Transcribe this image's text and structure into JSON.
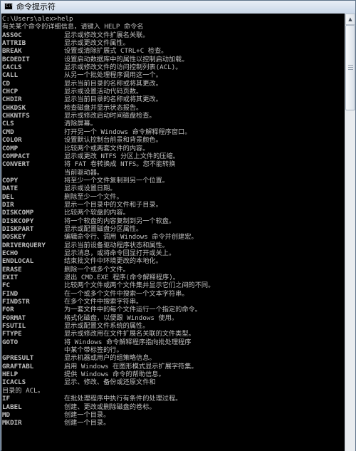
{
  "window": {
    "title": "命令提示符",
    "icon_text": "C:\\"
  },
  "console": {
    "prompt_line": "C:\\Users\\alex>help",
    "intro_line": "有关某个命令的详细信息，请键入 HELP 命令名",
    "entries": [
      {
        "cmd": "ASSOC",
        "desc": "显示或修改文件扩展名关联。"
      },
      {
        "cmd": "ATTRIB",
        "desc": "显示或更改文件属性。"
      },
      {
        "cmd": "BREAK",
        "desc": "设置或清除扩展式 CTRL+C 检查。"
      },
      {
        "cmd": "BCDEDIT",
        "desc": "设置启动数据库中的属性以控制启动加载。"
      },
      {
        "cmd": "CACLS",
        "desc": "显示或修改文件的访问控制列表(ACL)。"
      },
      {
        "cmd": "CALL",
        "desc": "从另一个批处理程序调用这一个。"
      },
      {
        "cmd": "CD",
        "desc": "显示当前目录的名称或将其更改。"
      },
      {
        "cmd": "CHCP",
        "desc": "显示或设置活动代码页数。"
      },
      {
        "cmd": "CHDIR",
        "desc": "显示当前目录的名称或将其更改。"
      },
      {
        "cmd": "CHKDSK",
        "desc": "检查磁盘并显示状态报告。"
      },
      {
        "cmd": "CHKNTFS",
        "desc": "显示或修改启动时间磁盘检查。"
      },
      {
        "cmd": "CLS",
        "desc": "清除屏幕。"
      },
      {
        "cmd": "CMD",
        "desc": "打开另一个 Windows 命令解释程序窗口。"
      },
      {
        "cmd": "COLOR",
        "desc": "设置默认控制台前景和背景颜色。"
      },
      {
        "cmd": "COMP",
        "desc": "比较两个或两套文件的内容。"
      },
      {
        "cmd": "COMPACT",
        "desc": "显示或更改 NTFS 分区上文件的压缩。"
      },
      {
        "cmd": "CONVERT",
        "desc": "将 FAT 卷转换成 NTFS。您不能转换"
      },
      {
        "cmd": "",
        "desc": "当前驱动器。"
      },
      {
        "cmd": "COPY",
        "desc": "将至少一个文件复制到另一个位置。"
      },
      {
        "cmd": "DATE",
        "desc": "显示或设置日期。"
      },
      {
        "cmd": "DEL",
        "desc": "删除至少一个文件。"
      },
      {
        "cmd": "DIR",
        "desc": "显示一个目录中的文件和子目录。"
      },
      {
        "cmd": "DISKCOMP",
        "desc": "比较两个软盘的内容。"
      },
      {
        "cmd": "DISKCOPY",
        "desc": "将一个软盘的内容复制到另一个软盘。"
      },
      {
        "cmd": "DISKPART",
        "desc": "显示或配置磁盘分区属性。"
      },
      {
        "cmd": "DOSKEY",
        "desc": "编辑命令行、调用 Windows 命令并创建宏。"
      },
      {
        "cmd": "DRIVERQUERY",
        "desc": "显示当前设备驱动程序状态和属性。"
      },
      {
        "cmd": "ECHO",
        "desc": "显示消息，或将命令回显打开或关上。"
      },
      {
        "cmd": "ENDLOCAL",
        "desc": "结束批文件中环境更改的本地化。"
      },
      {
        "cmd": "ERASE",
        "desc": "删除一个或多个文件。"
      },
      {
        "cmd": "EXIT",
        "desc": "退出 CMD.EXE 程序(命令解释程序)。"
      },
      {
        "cmd": "FC",
        "desc": "比较两个文件或两个文件集并显示它们之间的不同。"
      },
      {
        "cmd": "FIND",
        "desc": "在一个或多个文件中搜索一个文本字符串。"
      },
      {
        "cmd": "FINDSTR",
        "desc": "在多个文件中搜索字符串。"
      },
      {
        "cmd": "FOR",
        "desc": "为一套文件中的每个文件运行一个指定的命令。"
      },
      {
        "cmd": "FORMAT",
        "desc": "格式化磁盘，以便跟 Windows 使用。"
      },
      {
        "cmd": "FSUTIL",
        "desc": "显示或配置文件系统的属性。"
      },
      {
        "cmd": "FTYPE",
        "desc": "显示或修改用在文件扩展名关联的文件类型。"
      },
      {
        "cmd": "GOTO",
        "desc": "将 Windows 命令解释程序指向批处理程序"
      },
      {
        "cmd": "",
        "desc": "中某个带标签的行。"
      },
      {
        "cmd": "GPRESULT",
        "desc": "显示机器或用户的组策略信息。"
      },
      {
        "cmd": "GRAFTABL",
        "desc": "启用 Windows 在图形模式显示扩展字符集。"
      },
      {
        "cmd": "HELP",
        "desc": "提供 Windows 命令的帮助信息。"
      },
      {
        "cmd": "ICACLS",
        "desc": "显示、修改、备份或还原文件和"
      }
    ],
    "continuation_line": " 目录的 ACL。",
    "entries_after": [
      {
        "cmd": "IF",
        "desc": "在批处理程序中执行有条件的处理过程。"
      },
      {
        "cmd": "LABEL",
        "desc": "创建、更改或删除磁盘的卷标。"
      },
      {
        "cmd": "MD",
        "desc": "创建一个目录。"
      },
      {
        "cmd": "MKDIR",
        "desc": "创建一个目录。"
      }
    ]
  },
  "colors": {
    "console_bg": "#000000",
    "console_text": "#c0c0c0"
  }
}
